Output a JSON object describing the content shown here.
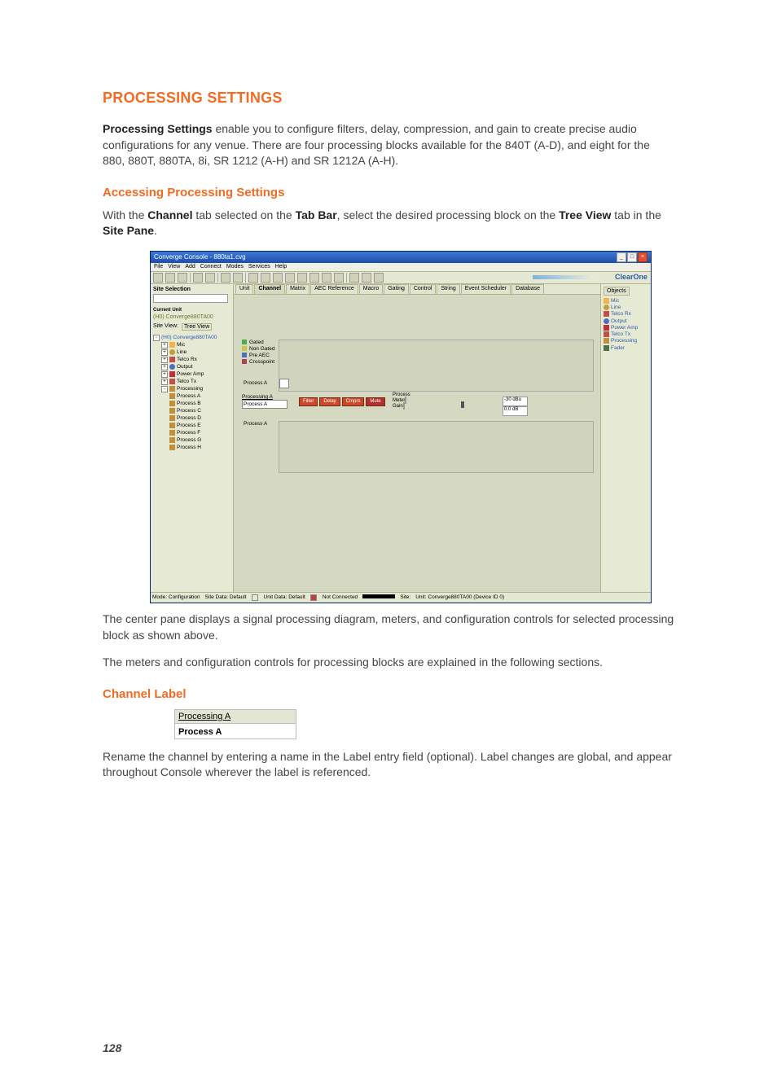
{
  "doc": {
    "title": "PROCESSING SETTINGS",
    "intro_prefix": "Processing Settings",
    "intro_rest": " enable you to configure filters, delay, compression, and gain to create precise audio configurations for any venue.  There are four processing blocks available for the 840T (A-D), and eight for the 880, 880T, 880TA, 8i, SR 1212 (A-H) and SR 1212A (A-H).",
    "sub1": "Accessing Processing Settings",
    "access_1": "With the ",
    "access_b1": "Channel",
    "access_2": " tab selected on the ",
    "access_b2": "Tab Bar",
    "access_3": ", select the desired processing block on the ",
    "access_b3": "Tree View",
    "access_4": " tab in the ",
    "access_b4": "Site Pane",
    "access_5": ".",
    "after1": "The center pane displays a signal processing diagram, meters, and configuration controls for selected processing block as shown above.",
    "after2": "The meters and configuration controls for processing blocks are explained in the following sections.",
    "sub2": "Channel Label",
    "chlabel_title": "Processing A",
    "chlabel_value": "Process A",
    "rename1": "Rename the channel by entering a name in the Label entry field (optional). Label changes are global, and appear throughout Console wherever the label is referenced.",
    "page_num": "128"
  },
  "app": {
    "title": "Converge Console - 880ta1.cvg",
    "menus": [
      "File",
      "View",
      "Add",
      "Connect",
      "Modes",
      "Services",
      "Help"
    ],
    "logo": "ClearOne",
    "site_selection": "Site Selection",
    "current_unit_lbl": "Current Unit",
    "current_unit": "(H0) Converge880TA00",
    "site_view": "Site View:",
    "site_view_tab": "Tree View",
    "tree_root": "(H0) Converge880TA00",
    "tree_nodes": [
      "Mic",
      "Line",
      "Telco Rx",
      "Output",
      "Power Amp",
      "Telco Tx",
      "Processing"
    ],
    "proc_items": [
      "Process A",
      "Process B",
      "Process C",
      "Process D",
      "Process E",
      "Process F",
      "Process G",
      "Process H"
    ],
    "mtabs": [
      "Unit",
      "Channel",
      "Matrix",
      "AEC Reference",
      "Macro",
      "Gating",
      "Control",
      "String",
      "Event Scheduler",
      "Database"
    ],
    "legend": [
      "Gated",
      "Non Gated",
      "Pre AEC",
      "Crosspoint"
    ],
    "pa_label": "Process A",
    "ch_title": "Processing A",
    "ch_value": "Process A",
    "btns": [
      "Filter",
      "Delay",
      "Cmprs",
      "Mute"
    ],
    "meter_lbls": [
      "Process",
      "Meter",
      "Gain"
    ],
    "gain1": "-30 dBu",
    "gain2": "0.0 dB",
    "objects_tab": "Objects",
    "objects": [
      "Mic",
      "Line",
      "Telco Rx",
      "Output",
      "Power Amp",
      "Telco Tx",
      "Processing",
      "Fader"
    ],
    "status": {
      "mode": "Mode: Configuration",
      "sitedata": "Site Data: Default",
      "unitdata": "Unit Data: Default",
      "conn": "Not Connected",
      "site": "Site:",
      "unit": "Unit: Converge880TA00 (Device ID 0)"
    }
  }
}
